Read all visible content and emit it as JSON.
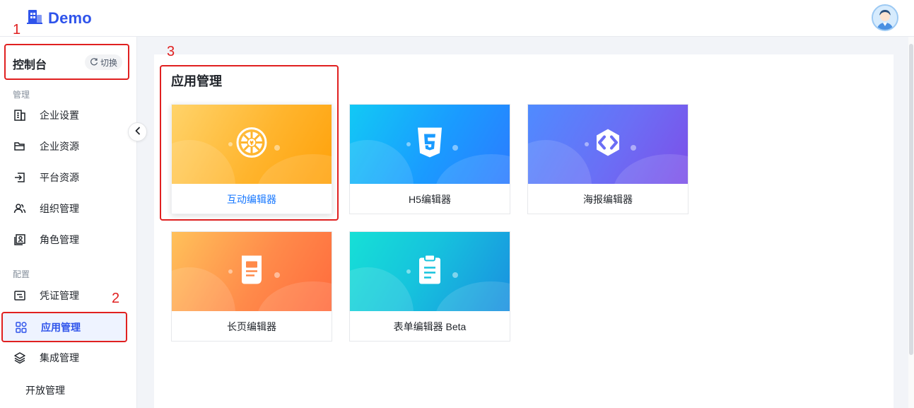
{
  "header": {
    "logo_text": "Demo"
  },
  "sidebar": {
    "console_title": "控制台",
    "switch_label": "切换",
    "groups": [
      {
        "label": "管理",
        "items": [
          {
            "label": "企业设置",
            "icon": "building-icon"
          },
          {
            "label": "企业资源",
            "icon": "folder-icon"
          },
          {
            "label": "平台资源",
            "icon": "login-icon"
          },
          {
            "label": "组织管理",
            "icon": "users-icon"
          },
          {
            "label": "角色管理",
            "icon": "id-card-icon"
          }
        ]
      },
      {
        "label": "配置",
        "items": [
          {
            "label": "凭证管理",
            "icon": "credential-icon"
          },
          {
            "label": "应用管理",
            "icon": "apps-icon",
            "active": true
          },
          {
            "label": "集成管理",
            "icon": "layers-icon"
          }
        ]
      }
    ],
    "extra_item": "开放管理"
  },
  "main": {
    "section_title": "应用管理",
    "cards": [
      {
        "label": "互动编辑器",
        "icon": "wheel-icon",
        "active": true
      },
      {
        "label": "H5编辑器",
        "icon": "html5-icon"
      },
      {
        "label": "海报编辑器",
        "icon": "hexagon-code-icon"
      },
      {
        "label": "长页编辑器",
        "icon": "page-icon"
      },
      {
        "label": "表单编辑器 Beta",
        "icon": "clipboard-icon"
      }
    ]
  },
  "annotations": [
    "1",
    "2",
    "3"
  ],
  "colors": {
    "accent": "#2f54eb",
    "active_text": "#1677ff",
    "annotation": "#e02020",
    "card_orange": "#ffb52e",
    "card_blue": "#1a9bff",
    "card_purple": "#6b6ef5",
    "card_coral": "#ff8a4a",
    "card_cyan": "#16c3dd"
  }
}
